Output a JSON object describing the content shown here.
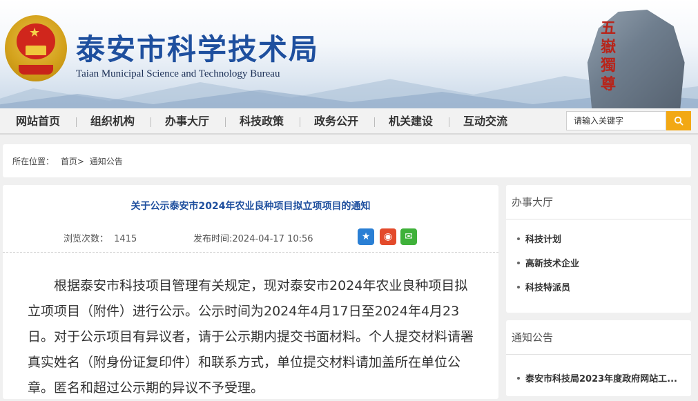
{
  "header": {
    "site_title": "泰安市科学技术局",
    "site_subtitle": "Taian Municipal Science and Technology Bureau",
    "rock_inscription": "五嶽獨尊"
  },
  "nav": {
    "items": [
      "网站首页",
      "组织机构",
      "办事大厅",
      "科技政策",
      "政务公开",
      "机关建设",
      "互动交流"
    ]
  },
  "search": {
    "placeholder": "请输入关键字",
    "icon": "search-icon"
  },
  "breadcrumb": {
    "label": "所在位置：",
    "home": "首页",
    "separator": ">",
    "current": "通知公告"
  },
  "article": {
    "title": "关于公示泰安市2024年农业良种项目拟立项项目的通知",
    "views_label": "浏览次数：",
    "views": "1415",
    "publish_label": "发布时间:",
    "publish_time": "2024-04-17 10:56",
    "share_icons": [
      "qzone-icon",
      "weibo-icon",
      "wechat-icon"
    ],
    "body": "根据泰安市科技项目管理有关规定，现对泰安市2024年农业良种项目拟立项项目（附件）进行公示。公示时间为2024年4月17日至2024年4月23日。对于公示项目有异议者，请于公示期内提交书面材料。个人提交材料请署真实姓名（附身份证复印件）和联系方式，单位提交材料请加盖所在单位公章。匿名和超过公示期的异议不予受理。"
  },
  "sidebar": {
    "office": {
      "title": "办事大厅",
      "items": [
        "科技计划",
        "高新技术企业",
        "科技特派员"
      ]
    },
    "notices": {
      "title": "通知公告",
      "items": [
        "泰安市科技局2023年度政府网站工..."
      ]
    }
  },
  "colors": {
    "title_blue": "#1e4f9e",
    "search_button": "#f2a814",
    "emblem_red": "#d0261c"
  }
}
